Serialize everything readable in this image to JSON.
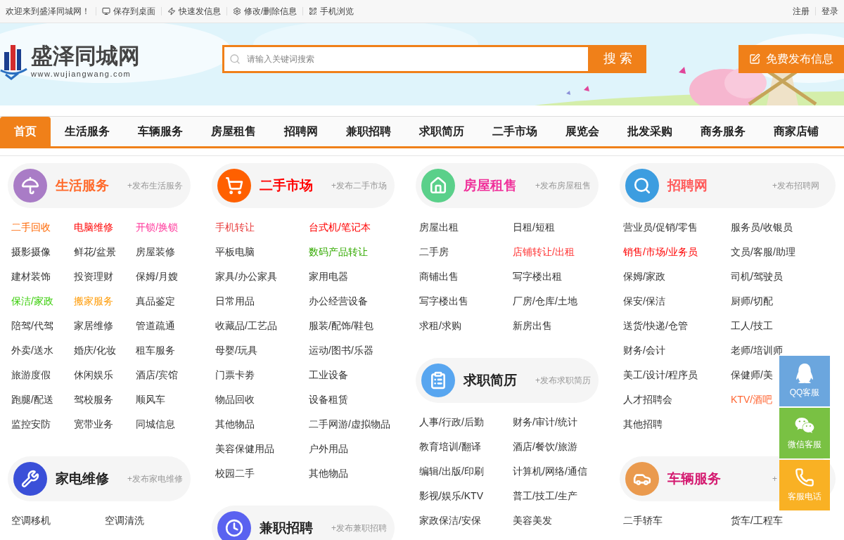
{
  "topbar": {
    "welcome": "欢迎来到盛泽同城网！",
    "links": [
      {
        "kind": "save",
        "label": "保存到桌面"
      },
      {
        "kind": "quick",
        "label": "快速发信息"
      },
      {
        "kind": "edit",
        "label": "修改/删除信息"
      },
      {
        "kind": "mobile",
        "label": "手机浏览"
      }
    ],
    "account": [
      "注册",
      "登录"
    ]
  },
  "header": {
    "logo_title": "盛泽同城网",
    "logo_url": "www.wujiangwang.com",
    "search": {
      "placeholder": "请输入关键词搜索",
      "button": "搜 索"
    },
    "post_button": "免费发布信息"
  },
  "nav": [
    {
      "label": "首页",
      "selected": true
    },
    {
      "label": "生活服务",
      "selected": false
    },
    {
      "label": "车辆服务",
      "selected": false
    },
    {
      "label": "房屋租售",
      "selected": false
    },
    {
      "label": "招聘网",
      "selected": false
    },
    {
      "label": "兼职招聘",
      "selected": false
    },
    {
      "label": "求职简历",
      "selected": false
    },
    {
      "label": "二手市场",
      "selected": false
    },
    {
      "label": "展览会",
      "selected": false
    },
    {
      "label": "批发采购",
      "selected": false
    },
    {
      "label": "商务服务",
      "selected": false
    },
    {
      "label": "商家店铺",
      "selected": false
    }
  ],
  "columns": [
    [
      {
        "kind": "life",
        "title": "生活服务",
        "color": "#ff6a2b",
        "post": "+发布生活服务",
        "links": [
          {
            "text": "二手回收",
            "color": "#ff6600"
          },
          {
            "text": "电脑维修",
            "color": "#ff0000"
          },
          {
            "text": "开锁/换锁",
            "color": "#ff3399"
          },
          {
            "text": "摄影摄像"
          },
          {
            "text": "鲜花/盆景"
          },
          {
            "text": "房屋装修"
          },
          {
            "text": "建材装饰"
          },
          {
            "text": "投资理财"
          },
          {
            "text": "保姆/月嫂"
          },
          {
            "text": "保洁/家政",
            "color": "#33cc00"
          },
          {
            "text": "搬家服务",
            "color": "#ff9900"
          },
          {
            "text": "真品鉴定"
          },
          {
            "text": "陪驾/代驾"
          },
          {
            "text": "家居维修"
          },
          {
            "text": "管道疏通"
          },
          {
            "text": "外卖/送水"
          },
          {
            "text": "婚庆/化妆"
          },
          {
            "text": "租车服务"
          },
          {
            "text": "旅游度假"
          },
          {
            "text": "休闲娱乐"
          },
          {
            "text": "酒店/宾馆"
          },
          {
            "text": "跑腿/配送"
          },
          {
            "text": "驾校服务"
          },
          {
            "text": "顺风车"
          },
          {
            "text": "监控安防"
          },
          {
            "text": "宽带业务"
          },
          {
            "text": "同城信息"
          }
        ]
      },
      {
        "kind": "repair",
        "title": "家电维修",
        "color": "#222222",
        "post": "+发布家电维修",
        "links": [
          {
            "text": "空调移机"
          },
          {
            "text": "空调清洗"
          }
        ]
      }
    ],
    [
      {
        "kind": "market",
        "title": "二手市场",
        "color": "#ff0000",
        "post": "+发布二手市场",
        "links": [
          {
            "text": "手机转让",
            "color": "#e83c3c"
          },
          {
            "text": "台式机/笔记本",
            "color": "#ff0000"
          },
          {
            "text": "平板电脑"
          },
          {
            "text": "数码产品转让",
            "color": "#33aa00"
          },
          {
            "text": "家具/办公家具"
          },
          {
            "text": "家用电器"
          },
          {
            "text": "日常用品"
          },
          {
            "text": "办公经营设备"
          },
          {
            "text": "收藏品/工艺品"
          },
          {
            "text": "服装/配饰/鞋包"
          },
          {
            "text": "母婴/玩具"
          },
          {
            "text": "运动/图书/乐器"
          },
          {
            "text": "门票卡劵"
          },
          {
            "text": "工业设备"
          },
          {
            "text": "物品回收"
          },
          {
            "text": "设备租赁"
          },
          {
            "text": "其他物品"
          },
          {
            "text": "二手网游/虚拟物品"
          },
          {
            "text": "美容保健用品"
          },
          {
            "text": "户外用品"
          },
          {
            "text": "校园二手"
          },
          {
            "text": "其他物品"
          }
        ]
      },
      {
        "kind": "parttime",
        "title": "兼职招聘",
        "color": "#222222",
        "post": "+发布兼职招聘"
      }
    ],
    [
      {
        "kind": "housing",
        "title": "房屋租售",
        "color": "#f0309a",
        "post": "+发布房屋租售",
        "links": [
          {
            "text": "房屋出租"
          },
          {
            "text": "日租/短租"
          },
          {
            "text": "二手房"
          },
          {
            "text": "店铺转让/出租",
            "color": "#ff3333"
          },
          {
            "text": "商铺出售"
          },
          {
            "text": "写字楼出租"
          },
          {
            "text": "写字楼出售"
          },
          {
            "text": "厂房/仓库/土地"
          },
          {
            "text": "求租/求购"
          },
          {
            "text": "新房出售"
          }
        ]
      },
      {
        "kind": "resume",
        "title": "求职简历",
        "color": "#222222",
        "post": "+发布求职简历",
        "links": [
          {
            "text": "人事/行政/后勤"
          },
          {
            "text": "财务/审计/统计"
          },
          {
            "text": "教育培训/翻译"
          },
          {
            "text": "酒店/餐饮/旅游"
          },
          {
            "text": "编辑/出版/印刷"
          },
          {
            "text": "计算机/网络/通信"
          },
          {
            "text": "影视/娱乐/KTV"
          },
          {
            "text": "普工/技工/生产"
          },
          {
            "text": "家政保洁/安保"
          },
          {
            "text": "美容美发"
          }
        ]
      }
    ],
    [
      {
        "kind": "jobs",
        "title": "招聘网",
        "color": "#ff5a5a",
        "post": "+发布招聘网",
        "links": [
          {
            "text": "营业员/促销/零售"
          },
          {
            "text": "服务员/收银员"
          },
          {
            "text": "销售/市场/业务员",
            "color": "#ff0000"
          },
          {
            "text": "文员/客服/助理"
          },
          {
            "text": "保姆/家政"
          },
          {
            "text": "司机/驾驶员"
          },
          {
            "text": "保安/保洁"
          },
          {
            "text": "厨师/切配"
          },
          {
            "text": "送货/快递/仓管"
          },
          {
            "text": "工人/技工"
          },
          {
            "text": "财务/会计"
          },
          {
            "text": "老师/培训师"
          },
          {
            "text": "美工/设计/程序员"
          },
          {
            "text": "保健师/美"
          },
          {
            "text": "人才招聘会"
          },
          {
            "text": "KTV/酒吧",
            "color": "#ff6633"
          },
          {
            "text": "其他招聘"
          }
        ]
      },
      {
        "kind": "vehicle",
        "title": "车辆服务",
        "color": "#d4196f",
        "post": "+",
        "links": [
          {
            "text": "二手轿车"
          },
          {
            "text": "货车/工程车"
          }
        ]
      }
    ]
  ],
  "float": [
    {
      "kind": "qq",
      "label": "QQ客服"
    },
    {
      "kind": "wechat",
      "label": "微信客服"
    },
    {
      "kind": "phone",
      "label": "客服电话"
    }
  ]
}
